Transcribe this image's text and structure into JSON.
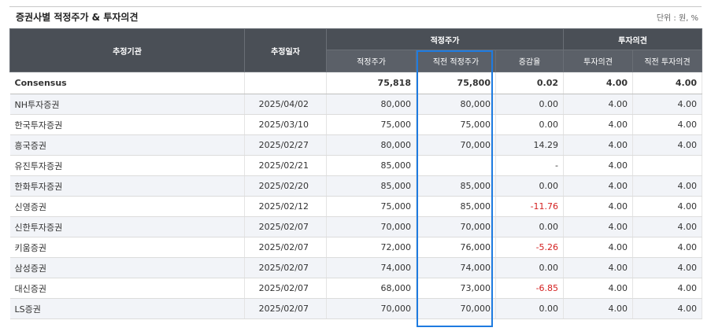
{
  "header": {
    "title": "증권사별 적정주가 & 투자의견",
    "unit": "단위 : 원, %"
  },
  "columns": {
    "org": "추정기관",
    "date": "추정일자",
    "group_price": "적정주가",
    "group_opinion": "투자의견",
    "target_price": "적정주가",
    "prev_target_price": "직전 적정주가",
    "change_rate": "증감율",
    "opinion": "투자의견",
    "prev_opinion": "직전 투자의견"
  },
  "consensus": {
    "name": "Consensus",
    "date": "",
    "target_price": "75,818",
    "prev_target_price": "75,800",
    "change_rate": "0.02",
    "opinion": "4.00",
    "prev_opinion": "4.00"
  },
  "rows": [
    {
      "name": "NH투자증권",
      "date": "2025/04/02",
      "target_price": "80,000",
      "prev_target_price": "80,000",
      "change_rate": "0.00",
      "opinion": "4.00",
      "prev_opinion": "4.00"
    },
    {
      "name": "한국투자증권",
      "date": "2025/03/10",
      "target_price": "75,000",
      "prev_target_price": "75,000",
      "change_rate": "0.00",
      "opinion": "4.00",
      "prev_opinion": "4.00"
    },
    {
      "name": "흥국증권",
      "date": "2025/02/27",
      "target_price": "80,000",
      "prev_target_price": "70,000",
      "change_rate": "14.29",
      "opinion": "4.00",
      "prev_opinion": "4.00"
    },
    {
      "name": "유진투자증권",
      "date": "2025/02/21",
      "target_price": "85,000",
      "prev_target_price": "",
      "change_rate": "-",
      "opinion": "4.00",
      "prev_opinion": ""
    },
    {
      "name": "한화투자증권",
      "date": "2025/02/20",
      "target_price": "85,000",
      "prev_target_price": "85,000",
      "change_rate": "0.00",
      "opinion": "4.00",
      "prev_opinion": "4.00"
    },
    {
      "name": "신영증권",
      "date": "2025/02/12",
      "target_price": "75,000",
      "prev_target_price": "85,000",
      "change_rate": "-11.76",
      "opinion": "4.00",
      "prev_opinion": "4.00"
    },
    {
      "name": "신한투자증권",
      "date": "2025/02/07",
      "target_price": "70,000",
      "prev_target_price": "70,000",
      "change_rate": "0.00",
      "opinion": "4.00",
      "prev_opinion": "4.00"
    },
    {
      "name": "키움증권",
      "date": "2025/02/07",
      "target_price": "72,000",
      "prev_target_price": "76,000",
      "change_rate": "-5.26",
      "opinion": "4.00",
      "prev_opinion": "4.00"
    },
    {
      "name": "삼성증권",
      "date": "2025/02/07",
      "target_price": "74,000",
      "prev_target_price": "74,000",
      "change_rate": "0.00",
      "opinion": "4.00",
      "prev_opinion": "4.00"
    },
    {
      "name": "대신증권",
      "date": "2025/02/07",
      "target_price": "68,000",
      "prev_target_price": "73,000",
      "change_rate": "-6.85",
      "opinion": "4.00",
      "prev_opinion": "4.00"
    },
    {
      "name": "LS증권",
      "date": "2025/02/07",
      "target_price": "70,000",
      "prev_target_price": "70,000",
      "change_rate": "0.00",
      "opinion": "4.00",
      "prev_opinion": "4.00"
    }
  ],
  "colors": {
    "header_bg": "#4a4f56",
    "negative": "#d42020",
    "highlight": "#1e7be0"
  }
}
